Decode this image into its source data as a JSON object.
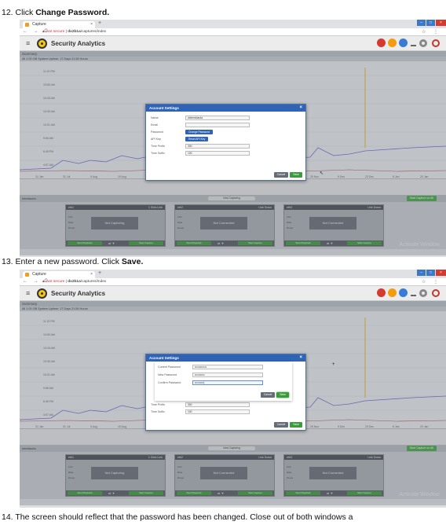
{
  "steps": [
    {
      "num": "12.",
      "pre": "Click ",
      "bold": "Change Password."
    },
    {
      "num": "13.",
      "pre": "Enter a new password. Click ",
      "bold": "Save."
    },
    {
      "num": "14.",
      "text": "The screen should reflect that the password has been changed. Close out of both windows a"
    }
  ],
  "browser": {
    "tab_title": "Capture",
    "tab_close": "×",
    "new_tab": "+",
    "not_secure": "Not secure",
    "url_host": "dx2b1a",
    "url_path": "/captures/index",
    "win_min": "–",
    "win_max": "□",
    "win_close": "×"
  },
  "app": {
    "title": "Security Analytics",
    "summary_label": "Summary",
    "uptime_text": "All 1:00 GB     System Uptime: 17 Days 21:56 Hours",
    "time_ticks": [
      "11:20 PM",
      "10:50 AM",
      "10:43 AM",
      "10:30 AM",
      "10:21 AM",
      "9:56 AM",
      "6:45 PM",
      "4:57 AM"
    ],
    "date_ticks": [
      "31 Jan",
      "31 Jul",
      "5 Aug",
      "19 Aug",
      "2 Sep",
      "16 Sep",
      "30 Sep",
      "14 Oct",
      "28 Oct",
      "11 Nov",
      "25 Nov",
      "9 Dec",
      "23 Dec",
      "6 Jan",
      "20 Jan"
    ],
    "interfaces_label": "Interfaces",
    "interfaces_center": "Intra Capturing",
    "start_all_label": "Start Capture on All",
    "activate_text": "Activate Window"
  },
  "cards": [
    {
      "name": "eth1",
      "rate": "1 Gb/s Link",
      "status": "Not Capturing",
      "btn1": "Start Playback",
      "btn2": "Start Capture"
    },
    {
      "name": "eth2",
      "rate": "Link Down",
      "status": "Not Connected",
      "btn1": "Start Playback",
      "btn2": "Start Capture"
    },
    {
      "name": "eth3",
      "rate": "Link Down",
      "status": "Not Connected",
      "btn1": "Start Playback",
      "btn2": "Start Capture"
    }
  ],
  "account_dialog": {
    "title": "Account Settings",
    "close": "×",
    "name_label": "Name",
    "name_value": "dxtemsbackz",
    "email_label": "Email",
    "email_value": "",
    "password_label": "Password",
    "change_password_button": "Change Password",
    "api_key_label": "API Key",
    "reset_api_key_button": "Reset API Key",
    "time_prefix_label": "Time Prefix",
    "time_prefix_value": "300",
    "time_suffix_label": "Time Suffix",
    "time_suffix_value": "100",
    "cancel_button": "Cancel",
    "save_button": "Save"
  },
  "password_dialog": {
    "current_label": "Current Password",
    "current_value": "•••••••••••••",
    "new_label": "New Password",
    "new_value": "•••••••••••",
    "confirm_label": "Confirm Password",
    "confirm_value": "••••••••••|",
    "cancel_button": "Cancel",
    "save_button": "Save"
  },
  "colors": {
    "primary_blue": "#2e63b5",
    "save_green": "#3d9b3d",
    "alert_red": "#d43a30",
    "status_orange": "#f39c12",
    "status_blue": "#3a7bd5"
  }
}
